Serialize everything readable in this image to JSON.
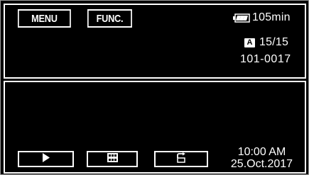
{
  "top_bar": {
    "menu_label": "MENU",
    "func_label": "FUNC."
  },
  "status": {
    "battery_icon": "battery-icon",
    "battery_remaining": "105min",
    "mode_badge": "A",
    "counter": "15/15",
    "file_number": "101-0017"
  },
  "controls": {
    "play_icon": "play-icon",
    "index_icon": "index-view-icon",
    "rotate_icon": "rotate-icon"
  },
  "datetime": {
    "time": "10:00 AM",
    "date": "25.Oct.2017"
  },
  "colors": {
    "background": "#000000",
    "border": "#ffffff",
    "text": "#ffffff",
    "frame": "#9a9a9a"
  }
}
